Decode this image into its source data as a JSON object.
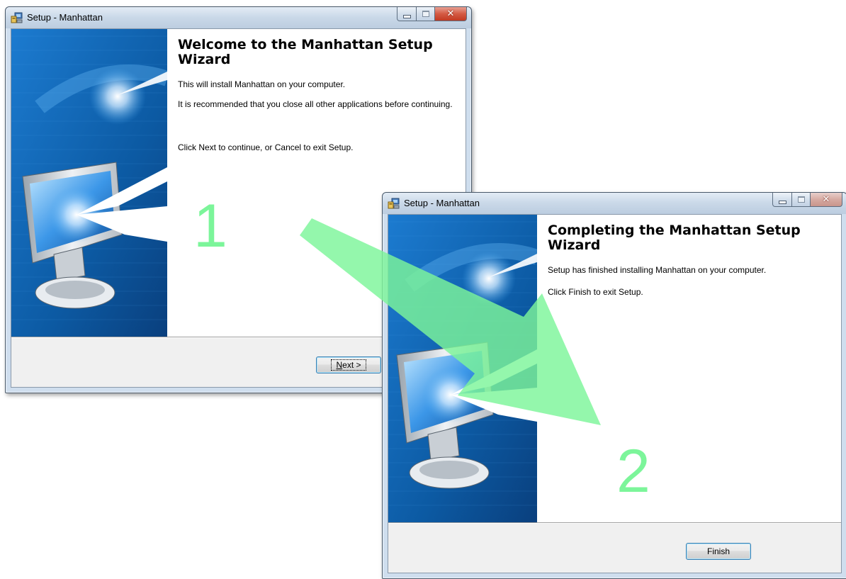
{
  "window1": {
    "title": "Setup - Manhattan",
    "heading": "Welcome to the Manhattan Setup Wizard",
    "paragraphs": [
      "This will install Manhattan on your computer.",
      "It is recommended that you close all other applications before continuing.",
      "Click Next to continue, or Cancel to exit Setup."
    ],
    "next_button": {
      "mnemonic": "N",
      "rest": "ext >"
    }
  },
  "window2": {
    "title": "Setup - Manhattan",
    "heading": "Completing the Manhattan Setup Wizard",
    "paragraphs": [
      "Setup has finished installing Manhattan on your computer.",
      "Click Finish to exit Setup."
    ],
    "finish_button": "Finish"
  },
  "step_labels": [
    "1",
    "2"
  ],
  "colors": {
    "annotation_green": "#7cf59a",
    "banner_blue": "#0d5fa8"
  },
  "icons": {
    "title_icon": "setup-icon",
    "minimize": "minimize-icon",
    "maximize": "maximize-icon",
    "close": "close-icon",
    "banner": "monitor-illustration"
  }
}
